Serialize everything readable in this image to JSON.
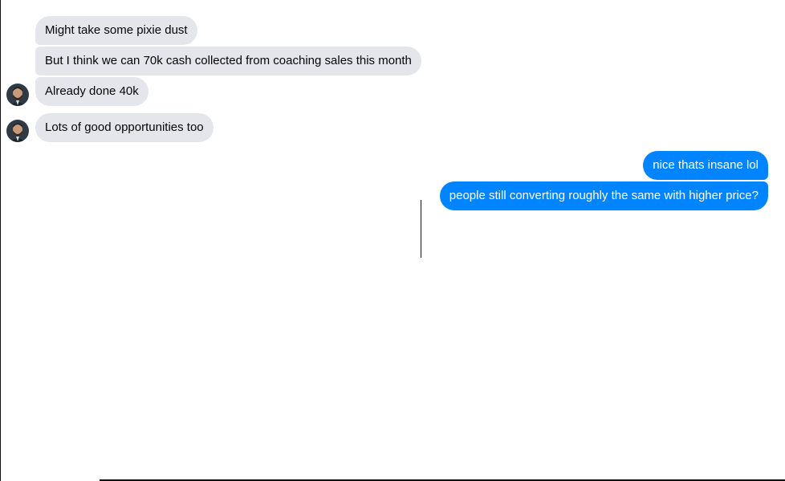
{
  "conversation": {
    "messages": [
      {
        "text": "Might take some pixie dust",
        "direction": "incoming"
      },
      {
        "text": "But I think we can 70k cash collected from coaching sales this month",
        "direction": "incoming"
      },
      {
        "text": "Already done 40k",
        "direction": "incoming"
      },
      {
        "text": "Lots of good opportunities too",
        "direction": "incoming"
      },
      {
        "text": "nice thats insane lol",
        "direction": "outgoing"
      },
      {
        "text": "people still converting roughly the same with higher price?",
        "direction": "outgoing"
      }
    ]
  },
  "colors": {
    "incoming_bubble": "#e4e6eb",
    "outgoing_bubble": "#0084ff",
    "incoming_text": "#050505",
    "outgoing_text": "#ffffff"
  },
  "icons": {
    "avatar": "contact-avatar-icon"
  }
}
